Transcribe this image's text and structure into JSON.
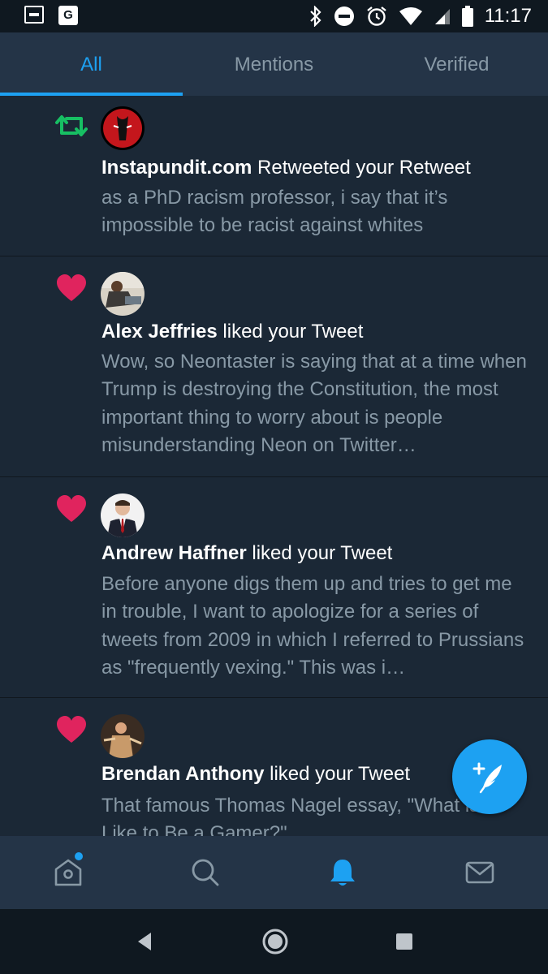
{
  "status_bar": {
    "time": "11:17",
    "left_icons": [
      "screen-recorder-icon",
      "google-maps-icon"
    ],
    "right_icons": [
      "bluetooth-icon",
      "do-not-disturb-icon",
      "alarm-icon",
      "wifi-icon",
      "cell-signal-icon",
      "battery-icon"
    ]
  },
  "tabs": [
    {
      "label": "All",
      "active": true
    },
    {
      "label": "Mentions",
      "active": false
    },
    {
      "label": "Verified",
      "active": false
    }
  ],
  "notifications": [
    {
      "type": "retweet",
      "icon": "retweet-icon",
      "user": "Instapundit.com",
      "action": "Retweeted your Retweet",
      "text": "as a PhD racism professor, i say that it’s impossible to be racist against whites"
    },
    {
      "type": "like",
      "icon": "heart-icon",
      "user": "Alex Jeffries",
      "action": "liked your Tweet",
      "text": "Wow, so Neontaster is saying that at a time when Trump is destroying the Constitution, the most important thing to worry about is people misunderstanding Neon on Twitter…"
    },
    {
      "type": "like",
      "icon": "heart-icon",
      "user": "Andrew Haffner",
      "action": "liked your Tweet",
      "text": "Before anyone digs them up and tries to get me in trouble, I want to apologize for a series of tweets from 2009 in which I referred to Prussians as \"frequently vexing.\" This was i…"
    },
    {
      "type": "like",
      "icon": "heart-icon",
      "user": "Brendan Anthony",
      "action": "liked your Tweet",
      "text": "That famous Thomas Nagel essay, \"What is it Like to Be a Gamer?\""
    }
  ],
  "fab": {
    "icon": "compose-tweet-icon"
  },
  "bottom_nav": [
    {
      "icon": "home-icon",
      "active": false,
      "has_dot": true
    },
    {
      "icon": "search-icon",
      "active": false,
      "has_dot": false
    },
    {
      "icon": "notifications-bell-icon",
      "active": true,
      "has_dot": false
    },
    {
      "icon": "messages-envelope-icon",
      "active": false,
      "has_dot": false
    }
  ],
  "system_nav": [
    "back-icon",
    "home-circle-icon",
    "recents-icon"
  ],
  "colors": {
    "accent": "#1da1f2",
    "background": "#1b2836",
    "header": "#243447",
    "secondary_text": "#8899a6",
    "like": "#e0245e",
    "retweet": "#17bf63"
  }
}
